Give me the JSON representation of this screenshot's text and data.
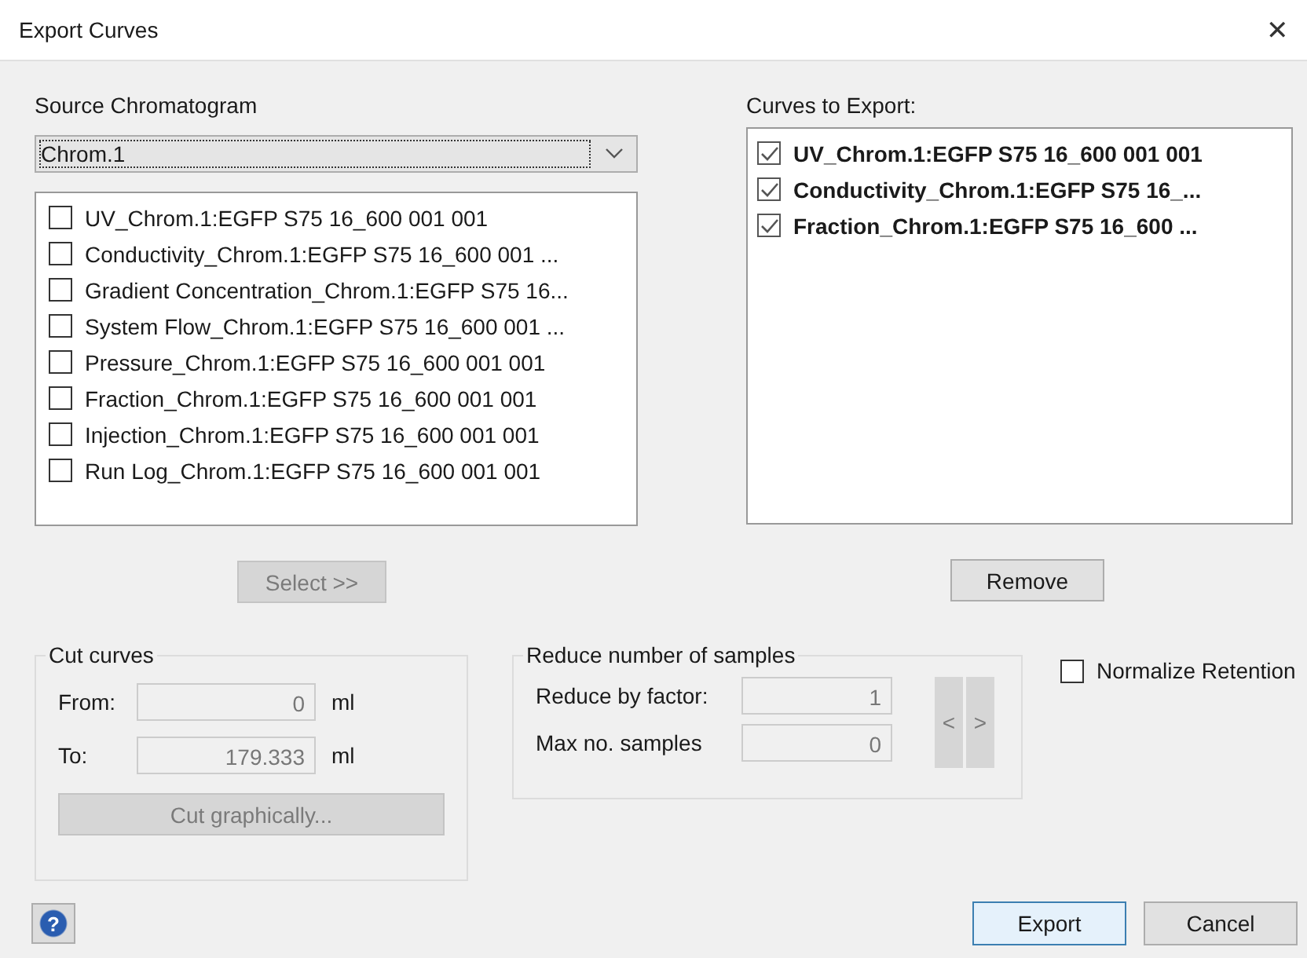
{
  "window": {
    "title": "Export Curves",
    "close": "✕"
  },
  "source": {
    "label": "Source Chromatogram",
    "combo_value": "Chrom.1",
    "items": [
      {
        "label": "UV_Chrom.1:EGFP S75 16_600 001 001",
        "checked": false
      },
      {
        "label": "Conductivity_Chrom.1:EGFP S75 16_600 001 ...",
        "checked": false
      },
      {
        "label": "Gradient Concentration_Chrom.1:EGFP S75 16...",
        "checked": false
      },
      {
        "label": "System Flow_Chrom.1:EGFP S75 16_600 001 ...",
        "checked": false
      },
      {
        "label": "Pressure_Chrom.1:EGFP S75 16_600 001 001",
        "checked": false
      },
      {
        "label": "Fraction_Chrom.1:EGFP S75 16_600 001 001",
        "checked": false
      },
      {
        "label": "Injection_Chrom.1:EGFP S75 16_600 001 001",
        "checked": false
      },
      {
        "label": "Run Log_Chrom.1:EGFP S75 16_600 001 001",
        "checked": false
      }
    ],
    "button": {
      "label": "Select >>",
      "disabled": true
    }
  },
  "export_list": {
    "label": "Curves to Export:",
    "items": [
      {
        "label": "UV_Chrom.1:EGFP S75 16_600 001 001",
        "checked": true
      },
      {
        "label": "Conductivity_Chrom.1:EGFP S75 16_...",
        "checked": true
      },
      {
        "label": "Fraction_Chrom.1:EGFP S75 16_600 ...",
        "checked": true
      }
    ],
    "button": {
      "label": "Remove",
      "disabled": false
    }
  },
  "cut_curves": {
    "title": "Cut curves",
    "fields": [
      {
        "label": "From:",
        "value": "0",
        "unit": "ml",
        "disabled": true
      },
      {
        "label": "To:",
        "value": "179.333",
        "unit": "ml",
        "disabled": true
      }
    ],
    "button": {
      "label": "Cut graphically...",
      "disabled": true
    }
  },
  "reduce": {
    "title": "Reduce number of samples",
    "fields": [
      {
        "label": "Reduce by factor:",
        "value": "1",
        "disabled": true
      },
      {
        "label": "Max no. samples",
        "value": "0",
        "disabled": true
      }
    ],
    "arrows": [
      {
        "label": "<",
        "disabled": true
      },
      {
        "label": ">",
        "disabled": true
      }
    ]
  },
  "normalize": {
    "label": "Normalize Retention",
    "checked": false
  },
  "help_button": {
    "icon": "?"
  },
  "buttons": [
    {
      "label": "Export",
      "default": true
    },
    {
      "label": "Cancel",
      "default": false
    }
  ]
}
